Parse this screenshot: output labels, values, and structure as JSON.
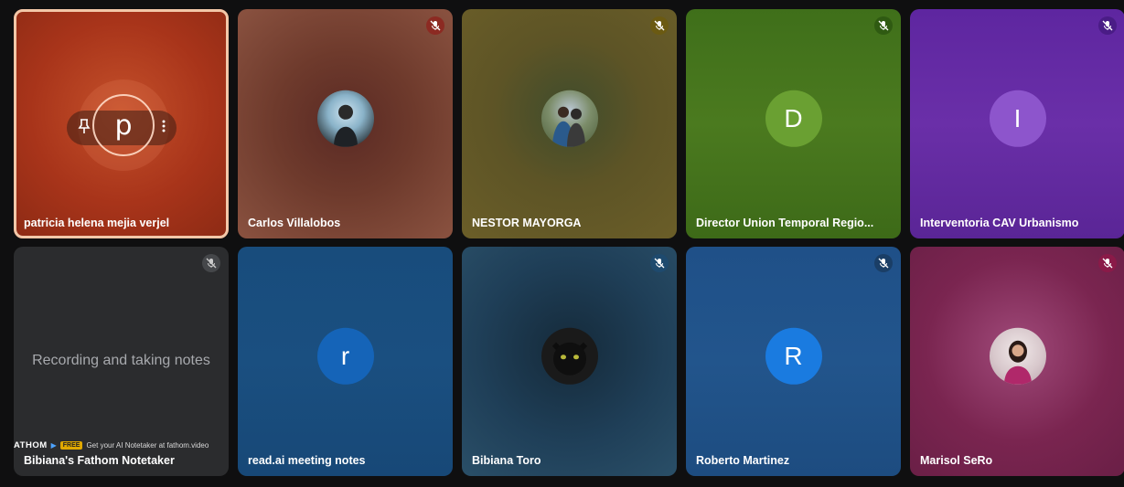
{
  "participants": [
    {
      "name": "patricia helena mejia verjel",
      "initial": "p",
      "active": true,
      "muted": false
    },
    {
      "name": "Carlos Villalobos",
      "initial": "",
      "muted": true
    },
    {
      "name": "NESTOR MAYORGA",
      "initial": "",
      "muted": true
    },
    {
      "name": "Director Union Temporal Regio...",
      "initial": "D",
      "muted": true
    },
    {
      "name": "Interventoria CAV Urbanismo",
      "initial": "I",
      "muted": true
    },
    {
      "name": "Bibiana's Fathom Notetaker",
      "initial": "",
      "muted": true,
      "status_text": "Recording and taking notes"
    },
    {
      "name": "read.ai meeting notes",
      "initial": "r",
      "muted": false
    },
    {
      "name": "Bibiana Toro",
      "initial": "",
      "muted": true
    },
    {
      "name": "Roberto Martinez",
      "initial": "R",
      "muted": true
    },
    {
      "name": "Marisol SeRo",
      "initial": "",
      "muted": true
    }
  ],
  "fathom_banner": {
    "brand": "ATHOM",
    "free_badge": "FREE",
    "text": "Get your AI Notetaker at fathom.video"
  },
  "colors": {
    "tile_1": "#a8341a",
    "tile_2": "#6e3a2c",
    "tile_3": "#5d5426",
    "tile_4": "#4b7a1f",
    "tile_5": "#6a2fa8",
    "tile_6": "#2b2c2e",
    "tile_7": "#1a4f80",
    "tile_8": "#1f3f58",
    "tile_9": "#22558c",
    "tile_10": "#7a2550"
  }
}
